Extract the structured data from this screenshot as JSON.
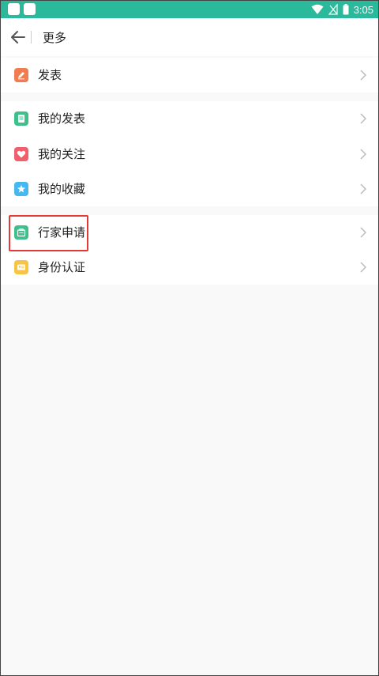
{
  "status_bar": {
    "time": "3:05"
  },
  "header": {
    "title": "更多"
  },
  "groups": [
    {
      "items": [
        {
          "label": "发表",
          "icon": "edit-icon",
          "color": "#f07c52"
        }
      ]
    },
    {
      "items": [
        {
          "label": "我的发表",
          "icon": "document-icon",
          "color": "#3fc08a"
        },
        {
          "label": "我的关注",
          "icon": "heart-icon",
          "color": "#f25f6c"
        },
        {
          "label": "我的收藏",
          "icon": "star-icon",
          "color": "#46b8f0"
        }
      ]
    },
    {
      "items": [
        {
          "label": "行家申请",
          "icon": "briefcase-icon",
          "color": "#3fc08a"
        },
        {
          "label": "身份认证",
          "icon": "id-card-icon",
          "color": "#f7c445"
        }
      ]
    }
  ],
  "highlight_color": "#e53935"
}
